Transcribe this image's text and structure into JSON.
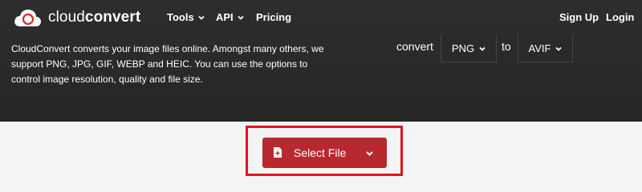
{
  "brand": {
    "name_light": "cloud",
    "name_bold": "convert",
    "icon": "cloudconvert-logo-icon"
  },
  "nav": {
    "tools": "Tools",
    "api": "API",
    "pricing": "Pricing",
    "signup": "Sign Up",
    "login": "Login"
  },
  "intro": "CloudConvert converts your image files online. Amongst many others, we support PNG, JPG, GIF, WEBP and HEIC. You can use the options to control image resolution, quality and file size.",
  "converter": {
    "convert_label": "convert",
    "from_format": "PNG",
    "to_label": "to",
    "to_format": "AVIF"
  },
  "upload": {
    "select_file_label": "Select File",
    "icon": "file-add-icon"
  },
  "colors": {
    "hero_bg": "#2b2b2b",
    "accent": "#b8292f",
    "highlight": "#e0141b",
    "page_bg": "#f4f4f4"
  }
}
